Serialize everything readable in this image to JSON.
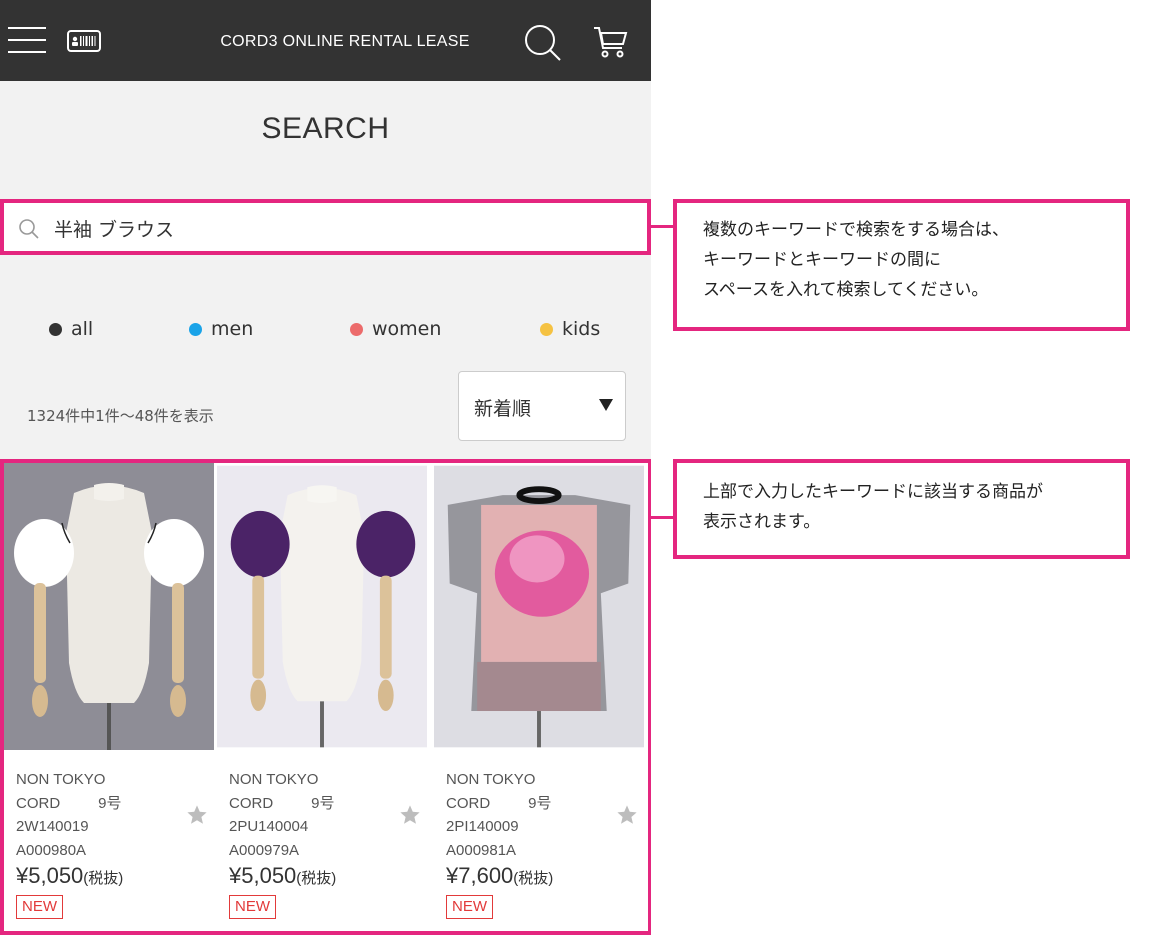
{
  "header": {
    "title": "CORD3 ONLINE RENTAL LEASE"
  },
  "page": {
    "title": "SEARCH"
  },
  "search": {
    "value": "半袖 ブラウス"
  },
  "genders": [
    {
      "label": "all",
      "color": "#333333"
    },
    {
      "label": "men",
      "color": "#1aa3e8"
    },
    {
      "label": "women",
      "color": "#ec6b6b"
    },
    {
      "label": "kids",
      "color": "#f5c242"
    }
  ],
  "results": {
    "count_text": "1324件中1件～48件を表示"
  },
  "sort": {
    "selected": "新着順"
  },
  "products": [
    {
      "brand": "NON TOKYO",
      "line": "CORD",
      "size": "9号",
      "code1": "2W140019",
      "code2": "A000980A",
      "price": "¥5,050",
      "tax": "(税抜)",
      "badge": "NEW"
    },
    {
      "brand": "NON TOKYO",
      "line": "CORD",
      "size": "9号",
      "code1": "2PU140004",
      "code2": "A000979A",
      "price": "¥5,050",
      "tax": "(税抜)",
      "badge": "NEW"
    },
    {
      "brand": "NON TOKYO",
      "line": "CORD",
      "size": "9号",
      "code1": "2PI140009",
      "code2": "A000981A",
      "price": "¥7,600",
      "tax": "(税抜)",
      "badge": "NEW"
    }
  ],
  "callouts": {
    "search": {
      "line1": "複数のキーワードで検索をする場合は、",
      "line2": "キーワードとキーワードの間に",
      "line3": "スペースを入れて検索してください。"
    },
    "results": {
      "line1": "上部で入力したキーワードに該当する商品が",
      "line2": "表示されます。"
    }
  },
  "colors": {
    "accent": "#e4267f",
    "header_bg": "#333333",
    "badge": "#e23a3a"
  }
}
